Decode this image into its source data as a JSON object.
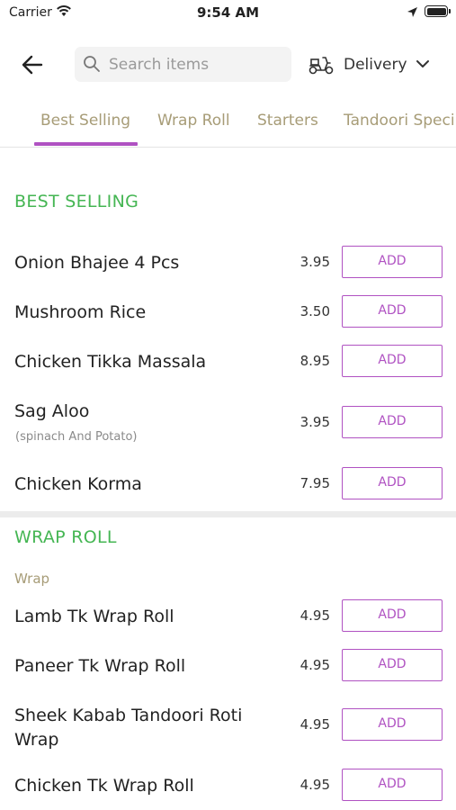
{
  "status_bar": {
    "carrier": "Carrier",
    "time": "9:54 AM"
  },
  "header": {
    "search_placeholder": "Search items",
    "delivery_label": "Delivery"
  },
  "tabs": [
    "Best Selling",
    "Wrap Roll",
    "Starters",
    "Tandoori Speci"
  ],
  "active_tab": "Best Selling",
  "accent_color": "#b052c2",
  "section_color": "#45b653",
  "sections": [
    {
      "title": "BEST SELLING",
      "items": [
        {
          "name": "Onion Bhajee 4 Pcs",
          "price": "3.95",
          "add_label": "ADD"
        },
        {
          "name": "Mushroom Rice",
          "price": "3.50",
          "add_label": "ADD"
        },
        {
          "name": "Chicken Tikka Massala",
          "price": "8.95",
          "add_label": "ADD"
        },
        {
          "name": "Sag Aloo",
          "description": "(spinach And Potato)",
          "price": "3.95",
          "add_label": "ADD"
        },
        {
          "name": "Chicken Korma",
          "price": "7.95",
          "add_label": "ADD"
        }
      ]
    },
    {
      "title": "WRAP ROLL",
      "subcategory": "Wrap",
      "items": [
        {
          "name": "Lamb Tk Wrap Roll",
          "price": "4.95",
          "add_label": "ADD"
        },
        {
          "name": "Paneer Tk Wrap Roll",
          "price": "4.95",
          "add_label": "ADD"
        },
        {
          "name": "Sheek Kabab Tandoori Roti Wrap",
          "price": "4.95",
          "add_label": "ADD"
        },
        {
          "name": "Chicken Tk Wrap Roll",
          "price": "4.95",
          "add_label": "ADD"
        }
      ]
    }
  ]
}
